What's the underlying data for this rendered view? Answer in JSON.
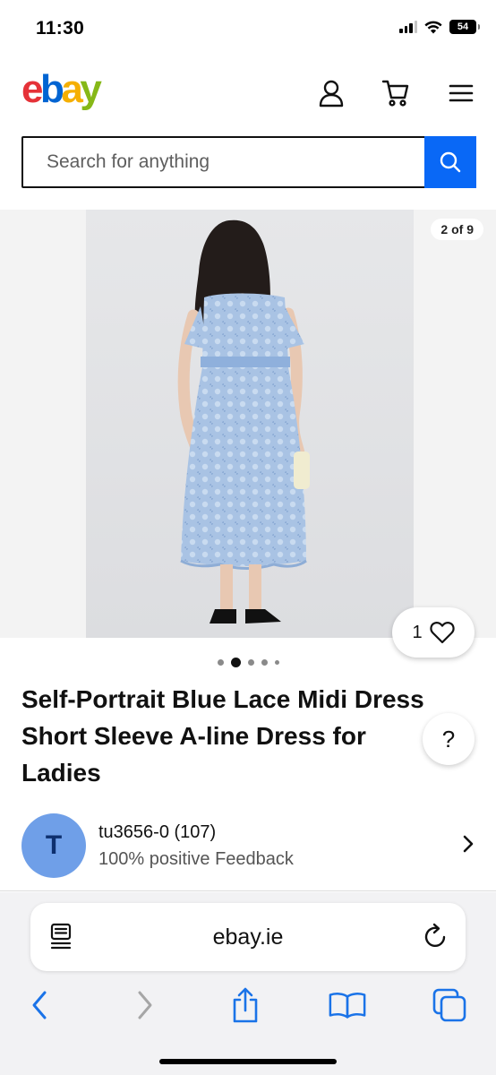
{
  "status_bar": {
    "time": "11:30",
    "battery": "54"
  },
  "header": {
    "logo_letters": [
      "e",
      "b",
      "a",
      "y"
    ]
  },
  "search": {
    "placeholder": "Search for anything"
  },
  "gallery": {
    "counter": "2 of 9",
    "watch_count": "1",
    "total_dots": 5,
    "active_dot": 2
  },
  "product": {
    "title_lines": [
      "Self-Portrait Blue Lace Midi Dress",
      "Short Sleeve A-line Dress for",
      "Ladies"
    ],
    "help_label": "?"
  },
  "seller": {
    "initial": "T",
    "name": "tu3656-0 (107)",
    "feedback": "100% positive Feedback"
  },
  "browser": {
    "url": "ebay.ie"
  },
  "colors": {
    "ebay_red": "#e53238",
    "ebay_blue": "#0064d2",
    "ebay_yellow": "#f5af02",
    "ebay_green": "#86b817",
    "search_button": "#0968f6",
    "safari_blue": "#1a73e8",
    "avatar_bg": "#6f9fe8"
  },
  "icons": [
    "user-icon",
    "cart-icon",
    "menu-icon",
    "search-icon",
    "heart-icon",
    "chevron-right-icon",
    "reader-icon",
    "reload-icon",
    "back-icon",
    "forward-icon",
    "share-icon",
    "bookmarks-icon",
    "tabs-icon"
  ]
}
